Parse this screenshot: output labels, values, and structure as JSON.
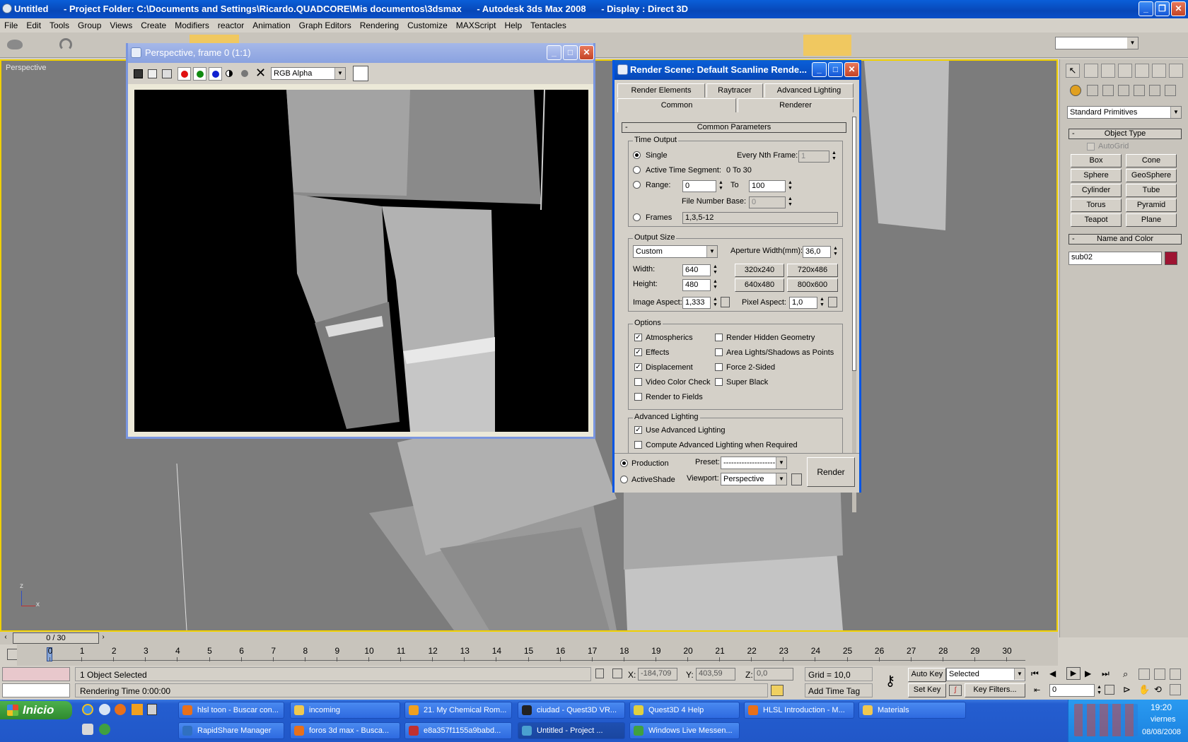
{
  "app": {
    "title": "Untitled      - Project Folder: C:\\Documents and Settings\\Ricardo.QUADCORE\\Mis documentos\\3dsmax      - Autodesk 3ds Max 2008      - Display : Direct 3D"
  },
  "menu": [
    "File",
    "Edit",
    "Tools",
    "Group",
    "Views",
    "Create",
    "Modifiers",
    "reactor",
    "Animation",
    "Graph Editors",
    "Rendering",
    "Customize",
    "MAXScript",
    "Help",
    "Tentacles"
  ],
  "viewport": {
    "label": "Perspective",
    "axis_z": "z",
    "axis_x": "x"
  },
  "frame_window": {
    "title": "Perspective, frame 0 (1:1)",
    "channel": "RGB Alpha"
  },
  "render_dialog": {
    "title": "Render Scene: Default Scanline Rende...",
    "tabs_row1": [
      "Render Elements",
      "Raytracer",
      "Advanced Lighting"
    ],
    "tabs_row2": [
      "Common",
      "Renderer"
    ],
    "rollout": "Common Parameters",
    "time_output": {
      "group": "Time Output",
      "single": "Single",
      "every_nth": "Every Nth Frame:",
      "every_nth_value": "1",
      "active_segment": "Active Time Segment:",
      "active_segment_value": "0 To 30",
      "range": "Range:",
      "range_from": "0",
      "to": "To",
      "range_to": "100",
      "file_number_base": "File Number Base:",
      "file_number_base_value": "0",
      "frames": "Frames",
      "frames_value": "1,3,5-12"
    },
    "output_size": {
      "group": "Output Size",
      "preset": "Custom",
      "aperture_label": "Aperture Width(mm):",
      "aperture_value": "36,0",
      "width_label": "Width:",
      "width_value": "640",
      "height_label": "Height:",
      "height_value": "480",
      "presets": [
        "320x240",
        "720x486",
        "640x480",
        "800x600"
      ],
      "image_aspect_label": "Image Aspect:",
      "image_aspect_value": "1,333",
      "pixel_aspect_label": "Pixel Aspect:",
      "pixel_aspect_value": "1,0"
    },
    "options": {
      "group": "Options",
      "left": [
        {
          "label": "Atmospherics",
          "checked": true
        },
        {
          "label": "Effects",
          "checked": true
        },
        {
          "label": "Displacement",
          "checked": true
        },
        {
          "label": "Video Color Check",
          "checked": false
        },
        {
          "label": "Render to Fields",
          "checked": false
        }
      ],
      "right": [
        {
          "label": "Render Hidden Geometry",
          "checked": false
        },
        {
          "label": "Area Lights/Shadows as Points",
          "checked": false
        },
        {
          "label": "Force 2-Sided",
          "checked": false
        },
        {
          "label": "Super Black",
          "checked": false
        }
      ]
    },
    "advanced_lighting": {
      "group": "Advanced Lighting",
      "use": "Use Advanced Lighting",
      "use_checked": true,
      "compute": "Compute Advanced Lighting when Required",
      "compute_checked": false
    },
    "bottom": {
      "production": "Production",
      "activeshade": "ActiveShade",
      "preset_label": "Preset:",
      "preset_value": "--------------------",
      "viewport_label": "Viewport:",
      "viewport_value": "Perspective",
      "render_button": "Render"
    }
  },
  "command_panel": {
    "category": "Standard Primitives",
    "object_type": "Object Type",
    "autogrid": "AutoGrid",
    "buttons": [
      "Box",
      "Cone",
      "Sphere",
      "GeoSphere",
      "Cylinder",
      "Tube",
      "Torus",
      "Pyramid",
      "Teapot",
      "Plane"
    ],
    "name_and_color": "Name and Color",
    "object_name": "sub02",
    "object_color": "#9e1432"
  },
  "timeline": {
    "slider": "0 / 30",
    "ticks": [
      "0",
      "1",
      "2",
      "3",
      "4",
      "5",
      "6",
      "7",
      "8",
      "9",
      "10",
      "11",
      "12",
      "13",
      "14",
      "15",
      "16",
      "17",
      "18",
      "19",
      "20",
      "21",
      "22",
      "23",
      "24",
      "25",
      "26",
      "27",
      "28",
      "29",
      "30"
    ]
  },
  "status": {
    "selection": "1 Object Selected",
    "render_time": "Rendering Time  0:00:00",
    "x_label": "X:",
    "x_value": "-184,709",
    "y_label": "Y:",
    "y_value": "403,59",
    "z_label": "Z:",
    "z_value": "0,0",
    "grid": "Grid = 10,0",
    "add_time_tag": "Add Time Tag",
    "auto_key": "Auto Key",
    "key_mode": "Selected",
    "set_key": "Set Key",
    "key_filters": "Key Filters...",
    "frame_value": "0"
  },
  "taskbar": {
    "start": "Inicio",
    "row1": [
      {
        "label": "hlsl toon - Buscar con...",
        "color": "#e8701a"
      },
      {
        "label": "incoming",
        "color": "#f0c850"
      },
      {
        "label": "21. My Chemical Rom...",
        "color": "#f0a020"
      },
      {
        "label": "ciudad - Quest3D VR...",
        "color": "#222222"
      },
      {
        "label": "Quest3D 4 Help",
        "color": "#e0d040"
      },
      {
        "label": "HLSL Introduction - M...",
        "color": "#e8701a"
      },
      {
        "label": "Materials",
        "color": "#f0c850"
      }
    ],
    "row2": [
      {
        "label": "RapidShare Manager",
        "color": "#3070c0"
      },
      {
        "label": "foros 3d max - Busca...",
        "color": "#e8701a"
      },
      {
        "label": "e8a357f1155a9babd...",
        "color": "#c03030"
      },
      {
        "label": "Untitled      - Project ...",
        "color": "#4aa0d0",
        "active": true
      },
      {
        "label": "Windows Live Messen...",
        "color": "#40a040"
      }
    ],
    "clock": "19:20",
    "day": "viernes",
    "date": "08/08/2008"
  }
}
